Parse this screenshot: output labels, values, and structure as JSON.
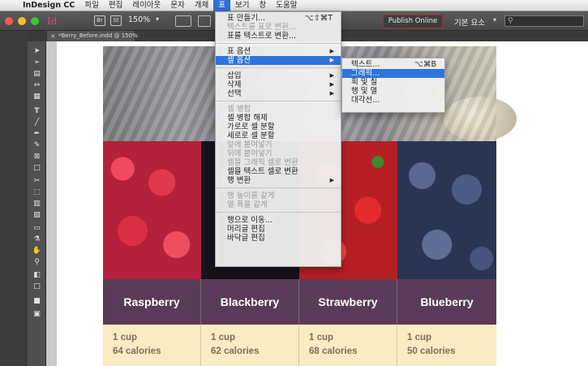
{
  "menubar": {
    "app_name": "InDesign CC",
    "items": [
      "파일",
      "편집",
      "레이아웃",
      "문자",
      "개체",
      "표",
      "보기",
      "창",
      "도움말"
    ]
  },
  "appbar": {
    "logo": "Id",
    "zoom": "150%",
    "publish_label": "Publish Online",
    "workspace": "기본 요소",
    "search_icon": "search-icon"
  },
  "document": {
    "tab_title": "*Berry_Before.indd @ 150%"
  },
  "table_menu": {
    "items": [
      {
        "label": "표 만들기...",
        "shortcut": "⌥⇧⌘T",
        "disabled": false
      },
      {
        "label": "텍스트를 표로 변환...",
        "disabled": true
      },
      {
        "label": "표를 텍스트로 변환...",
        "disabled": false
      },
      {
        "label": "표 옵션",
        "submenu": true,
        "disabled": false
      },
      {
        "label": "셀 옵션",
        "submenu": true,
        "highlight": true,
        "disabled": false
      },
      {
        "label": "삽입",
        "submenu": true,
        "disabled": false
      },
      {
        "label": "삭제",
        "submenu": true,
        "disabled": false
      },
      {
        "label": "선택",
        "submenu": true,
        "disabled": false
      },
      {
        "label": "셀 병합",
        "disabled": true
      },
      {
        "label": "셀 병합 해제",
        "disabled": false
      },
      {
        "label": "가로로 셀 분할",
        "disabled": false
      },
      {
        "label": "세로로 셀 분할",
        "disabled": false
      },
      {
        "label": "앞에 붙여넣기",
        "disabled": true
      },
      {
        "label": "뒤에 붙여넣기",
        "disabled": true
      },
      {
        "label": "셀을 그래픽 셀로 변환",
        "disabled": true
      },
      {
        "label": "셀을 텍스트 셀로 변환",
        "disabled": false
      },
      {
        "label": "행 변환",
        "submenu": true,
        "disabled": false
      },
      {
        "label": "행 높이를 같게",
        "disabled": true
      },
      {
        "label": "열 폭을 같게",
        "disabled": true
      },
      {
        "label": "행으로 이동...",
        "disabled": false
      },
      {
        "label": "머리글 편집",
        "disabled": false
      },
      {
        "label": "바닥글 편집",
        "disabled": false
      }
    ]
  },
  "cell_options_submenu": {
    "items": [
      {
        "label": "텍스트...",
        "shortcut": "⌥⌘B"
      },
      {
        "label": "그래픽...",
        "highlight": true
      },
      {
        "label": "획 및 칠"
      },
      {
        "label": "행 및 열"
      },
      {
        "label": "대각선..."
      }
    ]
  },
  "table": {
    "columns": [
      {
        "name": "Raspberry",
        "amount": "1 cup",
        "calories": "64 calories"
      },
      {
        "name": "Blackberry",
        "amount": "1 cup",
        "calories": "62 calories"
      },
      {
        "name": "Strawberry",
        "amount": "1 cup",
        "calories": "68 calories"
      },
      {
        "name": "Blueberry",
        "amount": "1 cup",
        "calories": "50 calories"
      }
    ],
    "header_color": "#5a3b57",
    "info_color": "#f9ebc3"
  }
}
